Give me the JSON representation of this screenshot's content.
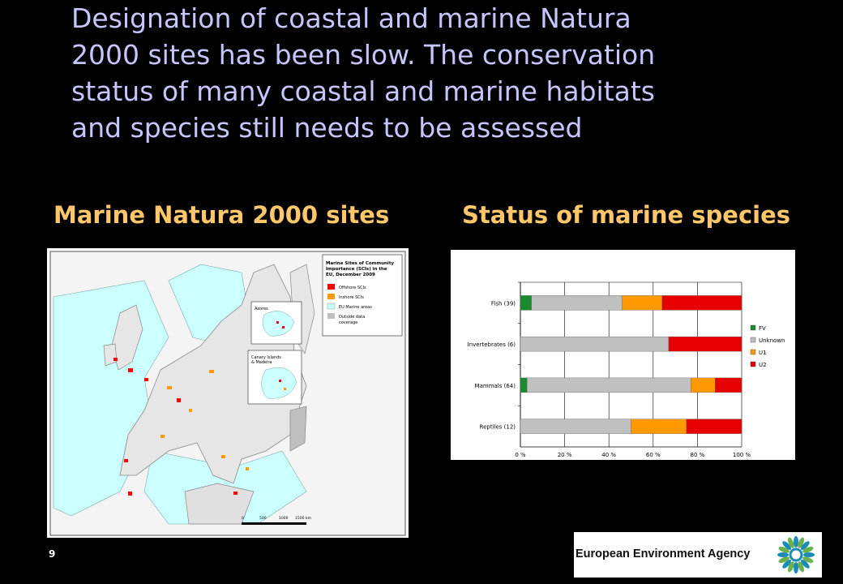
{
  "slide": {
    "headline_lines": [
      "Designation of coastal and marine Natura",
      "2000 sites has been slow. The conservation",
      "status of many coastal and marine habitats",
      "and species still needs to be assessed"
    ],
    "left_subtitle": "Marine Natura 2000 sites",
    "right_subtitle": "Status of marine species",
    "page_number": "9"
  },
  "map": {
    "legend_title_lines": [
      "Marine Sites of Community",
      "Importance (SCIs) in the",
      "EU, December 2009"
    ],
    "legend_items": [
      {
        "label": "Offshore SCIs",
        "color": "#ff0000"
      },
      {
        "label": "Inshore SCIs",
        "color": "#ff9900"
      },
      {
        "label": "EU Marine areas",
        "color": "#ccffff"
      },
      {
        "label": "Outside data",
        "color": "#bfbfbf"
      }
    ],
    "legend_extra_line": "coverage",
    "inset_labels": [
      "Azores",
      "Canary Islands",
      "& Madeira"
    ],
    "scale_labels": [
      "0",
      "500",
      "1000",
      "1500 km"
    ]
  },
  "chart_data": {
    "type": "bar",
    "stacked": true,
    "orientation": "horizontal",
    "categories": [
      "Fish (39)",
      "Invertebrates (6)",
      "Mammals (64)",
      "Reptiles (12)"
    ],
    "series": [
      {
        "name": "FV",
        "color": "#1a8a2e",
        "values": [
          5,
          0,
          3,
          0
        ]
      },
      {
        "name": "Unknown",
        "color": "#c0c0c0",
        "values": [
          41,
          67,
          74,
          50
        ]
      },
      {
        "name": "U1",
        "color": "#ff9900",
        "values": [
          18,
          0,
          11,
          25
        ]
      },
      {
        "name": "U2",
        "color": "#e60000",
        "values": [
          36,
          33,
          12,
          25
        ]
      }
    ],
    "x_ticks": [
      "0 %",
      "20 %",
      "40 %",
      "60 %",
      "80 %",
      "100 %"
    ],
    "xlim": [
      0,
      100
    ],
    "grid": true,
    "legend_position": "right"
  },
  "logo": {
    "text": "European Environment Agency",
    "colors": [
      "#1a8bb5",
      "#6ab04c"
    ]
  }
}
